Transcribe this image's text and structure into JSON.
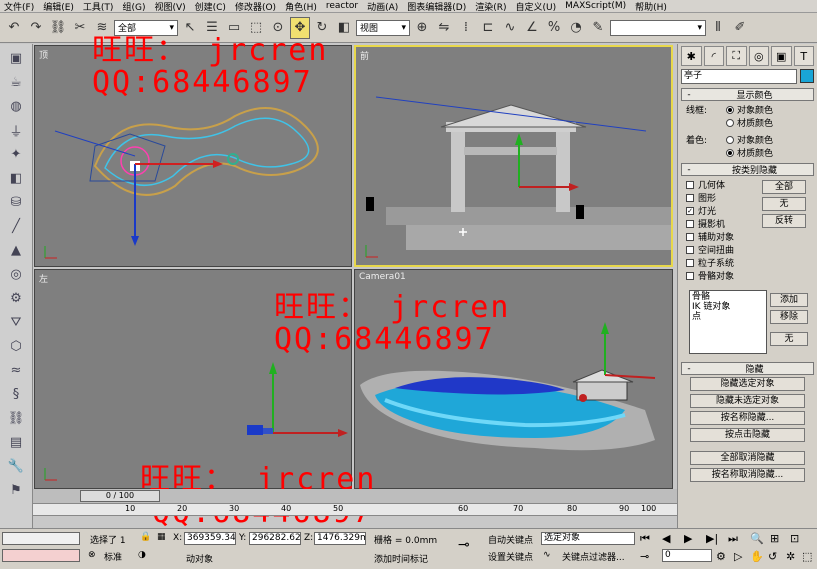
{
  "menubar": [
    "文件(F)",
    "编辑(E)",
    "工具(T)",
    "组(G)",
    "视图(V)",
    "创建(C)",
    "修改器(O)",
    "角色(H)",
    "reactor",
    "动画(A)",
    "图表编辑器(D)",
    "渲染(R)",
    "自定义(U)",
    "MAXScript(M)",
    "帮助(H)"
  ],
  "toolbar": {
    "selection_filter": "全部",
    "coord_system": "视图"
  },
  "viewports": {
    "top": "顶",
    "front": "前",
    "left": "左",
    "camera": "Camera01"
  },
  "watermarks": {
    "line1": "旺旺： jrcren",
    "line2": "QQ:68446897"
  },
  "command_panel": {
    "object_name": "亭子",
    "object_color": "#19a5d6",
    "display_color": {
      "title": "显示颜色",
      "wireframe_label": "线框:",
      "shaded_label": "着色:",
      "opt_object_color": "对象颜色",
      "opt_material_color": "材质颜色"
    },
    "hide_by_category": {
      "title": "按类别隐藏",
      "items": [
        "几何体",
        "图形",
        "灯光",
        "摄影机",
        "辅助对象",
        "空间扭曲",
        "粒子系统",
        "骨骼对象"
      ],
      "checked": [
        false,
        false,
        true,
        false,
        false,
        false,
        false,
        false
      ],
      "btn_all": "全部",
      "btn_none": "无",
      "btn_invert": "反转",
      "list": [
        "骨骼",
        "IK 链对象",
        "点"
      ],
      "btn_add": "添加",
      "btn_remove": "移除",
      "btn_none2": "无"
    },
    "hide": {
      "title": "隐藏",
      "buttons": [
        "隐藏选定对象",
        "隐藏未选定对象",
        "按名称隐藏...",
        "按点击隐藏",
        "全部取消隐藏",
        "按名称取消隐藏..."
      ]
    }
  },
  "timeline": {
    "frame_display": "0 / 100",
    "ticks": [
      "10",
      "20",
      "30",
      "40",
      "50",
      "60",
      "70",
      "80",
      "90",
      "100"
    ]
  },
  "status": {
    "selected": "选择了 1",
    "x_label": "X:",
    "x_value": "369359.34",
    "y_label": "Y:",
    "y_value": "296282.62",
    "z_label": "Z:",
    "z_value": "1476.329m",
    "grid": "栅格 = 0.0mm",
    "auto_key": "自动关键点",
    "set_key": "设置关键点",
    "selected_object": "选定对象",
    "key_filter": "关键点过滤器...",
    "frame_field": "0",
    "prompt": "动对象",
    "add_time_tag": "添加时间标记",
    "standard": "标准"
  }
}
